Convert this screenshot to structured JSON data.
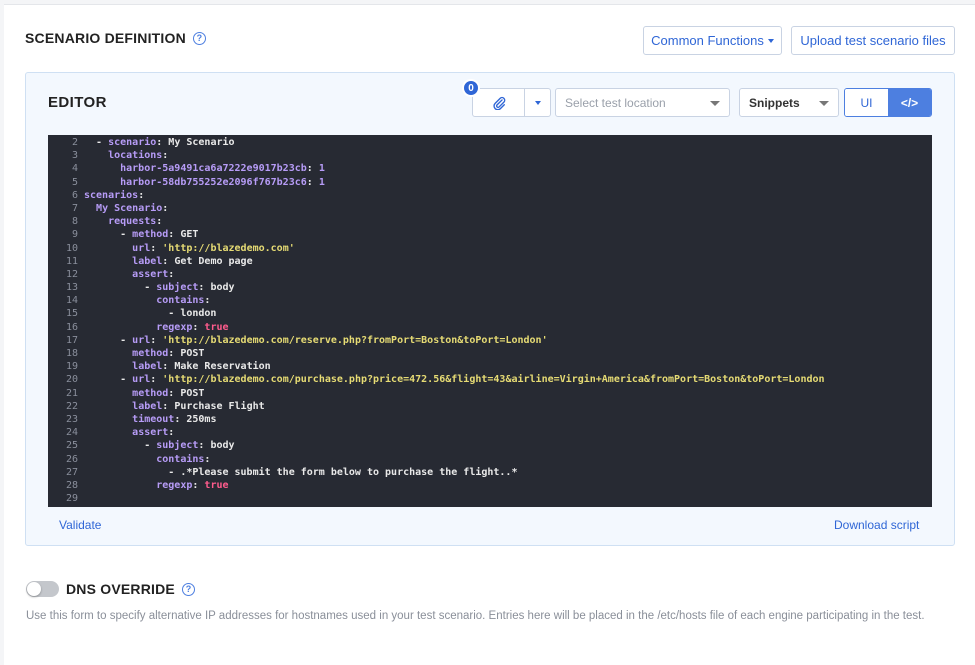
{
  "scenario_definition": {
    "title": "SCENARIO DEFINITION",
    "help_glyph": "?",
    "common_functions_label": "Common Functions",
    "upload_label": "Upload test scenario files"
  },
  "editor": {
    "title": "EDITOR",
    "attachments_count": "0",
    "location_placeholder": "Select test location",
    "snippets_label": "Snippets",
    "mode_ui_label": "UI",
    "mode_code_label": "</>",
    "validate_label": "Validate",
    "download_label": "Download script",
    "code_lines": [
      {
        "n": "2",
        "parts": [
          [
            "p",
            "  - "
          ],
          [
            "k",
            "scenario"
          ],
          [
            "p",
            ": My Scenario"
          ]
        ]
      },
      {
        "n": "3",
        "parts": [
          [
            "p",
            "    "
          ],
          [
            "k",
            "locations"
          ],
          [
            "p",
            ":"
          ]
        ]
      },
      {
        "n": "4",
        "parts": [
          [
            "p",
            "      "
          ],
          [
            "k",
            "harbor-5a9491ca6a7222e9017b23cb"
          ],
          [
            "p",
            ": "
          ],
          [
            "n",
            "1"
          ]
        ]
      },
      {
        "n": "5",
        "parts": [
          [
            "p",
            "      "
          ],
          [
            "k",
            "harbor-58db755252e2096f767b23c6"
          ],
          [
            "p",
            ": "
          ],
          [
            "n",
            "1"
          ]
        ]
      },
      {
        "n": "6",
        "parts": [
          [
            "k",
            "scenarios"
          ],
          [
            "p",
            ":"
          ]
        ]
      },
      {
        "n": "7",
        "parts": [
          [
            "p",
            "  "
          ],
          [
            "k",
            "My Scenario"
          ],
          [
            "p",
            ":"
          ]
        ]
      },
      {
        "n": "8",
        "parts": [
          [
            "p",
            "    "
          ],
          [
            "k",
            "requests"
          ],
          [
            "p",
            ":"
          ]
        ]
      },
      {
        "n": "9",
        "parts": [
          [
            "p",
            "      - "
          ],
          [
            "k",
            "method"
          ],
          [
            "p",
            ": GET"
          ]
        ]
      },
      {
        "n": "10",
        "parts": [
          [
            "p",
            "        "
          ],
          [
            "k",
            "url"
          ],
          [
            "p",
            ": "
          ],
          [
            "s",
            "'http://blazedemo.com'"
          ]
        ]
      },
      {
        "n": "11",
        "parts": [
          [
            "p",
            "        "
          ],
          [
            "k",
            "label"
          ],
          [
            "p",
            ": Get Demo page"
          ]
        ]
      },
      {
        "n": "12",
        "parts": [
          [
            "p",
            "        "
          ],
          [
            "k",
            "assert"
          ],
          [
            "p",
            ":"
          ]
        ]
      },
      {
        "n": "13",
        "parts": [
          [
            "p",
            "          - "
          ],
          [
            "k",
            "subject"
          ],
          [
            "p",
            ": body"
          ]
        ]
      },
      {
        "n": "14",
        "parts": [
          [
            "p",
            "            "
          ],
          [
            "k",
            "contains"
          ],
          [
            "p",
            ":"
          ]
        ]
      },
      {
        "n": "15",
        "parts": [
          [
            "p",
            "              - london"
          ]
        ]
      },
      {
        "n": "16",
        "parts": [
          [
            "p",
            "            "
          ],
          [
            "k",
            "regexp"
          ],
          [
            "p",
            ": "
          ],
          [
            "b",
            "true"
          ]
        ]
      },
      {
        "n": "17",
        "parts": [
          [
            "p",
            "      - "
          ],
          [
            "k",
            "url"
          ],
          [
            "p",
            ": "
          ],
          [
            "s",
            "'http://blazedemo.com/reserve.php?fromPort=Boston&toPort=London'"
          ]
        ]
      },
      {
        "n": "18",
        "parts": [
          [
            "p",
            "        "
          ],
          [
            "k",
            "method"
          ],
          [
            "p",
            ": POST"
          ]
        ]
      },
      {
        "n": "19",
        "parts": [
          [
            "p",
            "        "
          ],
          [
            "k",
            "label"
          ],
          [
            "p",
            ": Make Reservation"
          ]
        ]
      },
      {
        "n": "20",
        "parts": [
          [
            "p",
            "      - "
          ],
          [
            "k",
            "url"
          ],
          [
            "p",
            ": "
          ],
          [
            "s",
            "'http://blazedemo.com/purchase.php?price=472.56&flight=43&airline=Virgin+America&fromPort=Boston&toPort=London"
          ]
        ]
      },
      {
        "n": "21",
        "parts": [
          [
            "p",
            "        "
          ],
          [
            "k",
            "method"
          ],
          [
            "p",
            ": POST"
          ]
        ]
      },
      {
        "n": "22",
        "parts": [
          [
            "p",
            "        "
          ],
          [
            "k",
            "label"
          ],
          [
            "p",
            ": Purchase Flight"
          ]
        ]
      },
      {
        "n": "23",
        "parts": [
          [
            "p",
            "        "
          ],
          [
            "k",
            "timeout"
          ],
          [
            "p",
            ": 250ms"
          ]
        ]
      },
      {
        "n": "24",
        "parts": [
          [
            "p",
            "        "
          ],
          [
            "k",
            "assert"
          ],
          [
            "p",
            ":"
          ]
        ]
      },
      {
        "n": "25",
        "parts": [
          [
            "p",
            "          - "
          ],
          [
            "k",
            "subject"
          ],
          [
            "p",
            ": body"
          ]
        ]
      },
      {
        "n": "26",
        "parts": [
          [
            "p",
            "            "
          ],
          [
            "k",
            "contains"
          ],
          [
            "p",
            ":"
          ]
        ]
      },
      {
        "n": "27",
        "parts": [
          [
            "p",
            "              - .*Please submit the form below to purchase the flight..*"
          ]
        ]
      },
      {
        "n": "28",
        "parts": [
          [
            "p",
            "            "
          ],
          [
            "k",
            "regexp"
          ],
          [
            "p",
            ": "
          ],
          [
            "b",
            "true"
          ]
        ]
      },
      {
        "n": "29",
        "parts": []
      }
    ]
  },
  "dns_override": {
    "title": "DNS OVERRIDE",
    "help_glyph": "?",
    "enabled": false,
    "description": "Use this form to specify alternative IP addresses for hostnames used in your test scenario. Entries here will be placed in the /etc/hosts file of each engine participating in the test."
  },
  "icons": {
    "attach": "paperclip-icon",
    "help": "question-circle-icon"
  },
  "colors": {
    "accent": "#2f66d6",
    "toggle_active": "#4d7fe0",
    "editor_bg": "#272a33"
  }
}
